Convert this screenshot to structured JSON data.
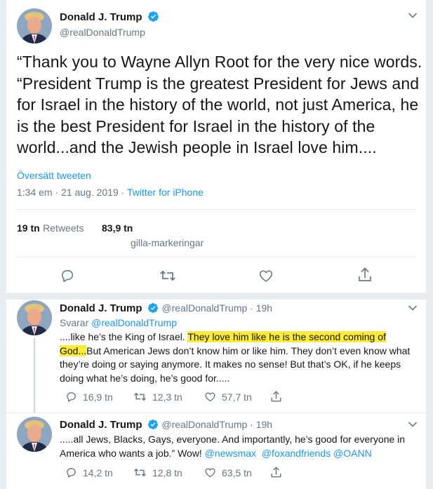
{
  "main_tweet": {
    "author_name": "Donald J. Trump",
    "author_handle": "@realDonaldTrump",
    "text": "“Thank you to Wayne Allyn Root for the very nice words. “President Trump is the greatest President for Jews and for Israel in the history of the world, not just America, he is the best President for Israel in the history of the world...and the Jewish people in Israel love him....",
    "translate_label": "Översätt tweeten",
    "timestamp": "1:34 em · 21 aug. 2019 ·",
    "source": "Twitter for iPhone",
    "retweets_count": "19 tn",
    "retweets_label": "Retweets",
    "likes_count": "83,9 tn",
    "likes_label": "gilla-markeringar"
  },
  "replies": [
    {
      "author_name": "Donald J. Trump",
      "author_handle": "@realDonaldTrump · 19h",
      "replying_label": "Svarar",
      "replying_handle": "@realDonaldTrump",
      "text_before": "....like he’s the King of Israel. ",
      "text_highlight": "They love him like he is the second coming of God...",
      "text_after": "But American Jews don’t know him or like him. They don’t even know what they’re doing or saying anymore. It makes no sense! But that’s OK, if he keeps doing what he’s doing, he’s good for.....",
      "reply_count": "16,9 tn",
      "retweet_count": "12,3 tn",
      "like_count": "57,7 tn"
    },
    {
      "author_name": "Donald J. Trump",
      "author_handle": "@realDonaldTrump · 19h",
      "text_before": ".....all Jews, Blacks, Gays, everyone. And importantly, he’s good for everyone in America who wants a job.” Wow! ",
      "mention_1": "@newsmax",
      "mention_2": "@foxandfriends",
      "mention_3": "@OANN",
      "reply_count": "14,2 tn",
      "retweet_count": "12,8 tn",
      "like_count": "63,5 tn"
    }
  ],
  "colors": {
    "accent": "#1b95e0",
    "verified": "#1da1f2",
    "highlight": "#ffeb3b",
    "muted": "#657786"
  },
  "icons": [
    "verified-badge-icon",
    "chevron-down-icon",
    "reply-icon",
    "retweet-icon",
    "like-icon",
    "share-icon"
  ]
}
